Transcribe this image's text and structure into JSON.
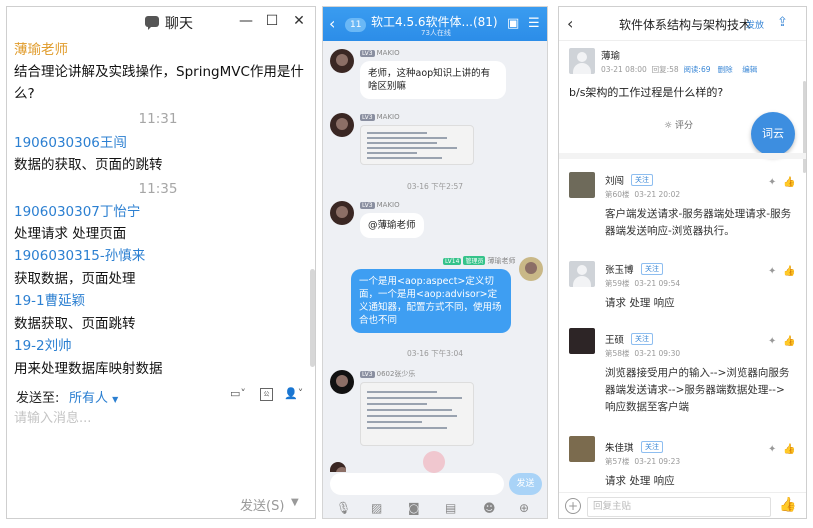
{
  "chat_window": {
    "title": "聊天",
    "icon": "chat-bubble-icon",
    "messages": [
      {
        "kind": "name",
        "text": "薄瑜老师",
        "color": "#e09b2a"
      },
      {
        "kind": "body",
        "text": "结合理论讲解及实践操作，SpringMVC作用是什"
      },
      {
        "kind": "body",
        "text": "么?"
      },
      {
        "kind": "time",
        "text": "11:31"
      },
      {
        "kind": "name",
        "text": "1906030306王闯",
        "color": "#2b7fd1"
      },
      {
        "kind": "body",
        "text": "数据的获取、页面的跳转"
      },
      {
        "kind": "time",
        "text": "11:35"
      },
      {
        "kind": "name",
        "text": "1906030307丁怡宁",
        "color": "#2b7fd1"
      },
      {
        "kind": "body",
        "text": "处理请求 处理页面"
      },
      {
        "kind": "name",
        "text": "1906030315-孙慎来",
        "color": "#2b7fd1"
      },
      {
        "kind": "body",
        "text": "获取数据，页面处理"
      },
      {
        "kind": "name",
        "text": "19-1曹延颖",
        "color": "#2b7fd1"
      },
      {
        "kind": "body",
        "text": "数据获取、页面跳转"
      },
      {
        "kind": "name",
        "text": "19-2刘帅",
        "color": "#2b7fd1"
      },
      {
        "kind": "body",
        "text": "用来处理数据库映射数据"
      }
    ],
    "send_to_label": "发送至:",
    "send_to_value": "所有人",
    "input_placeholder": "请输入消息...",
    "send_label": "发送(S)"
  },
  "group_chat": {
    "back_count": "11",
    "title": "软工4.5.6软件体...(81)",
    "subtitle": "73人在线",
    "header_icons": [
      "calendar-check-icon",
      "menu-icon"
    ],
    "msg1_tag": "LV3",
    "msg1_name": "MAKIO",
    "msg1_text": "老师，这种aop知识上讲的有啥区别嘛",
    "msg2_tag": "LV3",
    "msg2_name": "MAKIO",
    "time1": "03-16 下午2:57",
    "msg3_tag": "LV3",
    "msg3_name": "MAKIO",
    "msg3_text": "@薄瑜老师",
    "msg4_tag": "LV14",
    "msg4_role": "管理员",
    "msg4_name": "薄瑜老师",
    "msg4_text": "一个是用<aop:aspect>定义切面，一个是用<aop:advisor>定义通知器，配置方式不同，使用场合也不同",
    "time2": "03-16 下午3:04",
    "msg5_tag": "LV3",
    "msg5_name": "0602张少乐",
    "send_label": "发送",
    "toolbar_icons": [
      "microphone-icon",
      "image-icon",
      "camera-icon",
      "red-packet-icon",
      "emoji-icon",
      "plus-icon"
    ]
  },
  "forum": {
    "title": "软件体系结构与架构技术",
    "title_overlay": "发放",
    "author": {
      "name": "薄瑜",
      "date": "03-21 08:00",
      "reply_count": "回复:58",
      "views": "阅读:69",
      "delete": "删除",
      "edit": "编辑"
    },
    "question": "b/s架构的工作过程是什么样的?",
    "rate_label": "评分",
    "float_button": "词云",
    "follow_label": "关注",
    "replies": [
      {
        "name": "刘闯",
        "floor": "第60楼",
        "date": "03-21 20:02",
        "text": "客户端发送请求-服务器端处理请求-服务器端发送响应-浏览器执行。"
      },
      {
        "name": "张玉博",
        "floor": "第59楼",
        "date": "03-21 09:54",
        "text": "请求 处理 响应"
      },
      {
        "name": "王硕",
        "floor": "第58楼",
        "date": "03-21 09:30",
        "text": "浏览器接受用户的输入-->浏览器向服务器端发送请求-->服务器端数据处理-->响应数据至客户端"
      },
      {
        "name": "朱佳琪",
        "floor": "第57楼",
        "date": "03-21 09:23",
        "text": "请求 处理 响应"
      }
    ],
    "reply_placeholder": "回复主贴"
  }
}
